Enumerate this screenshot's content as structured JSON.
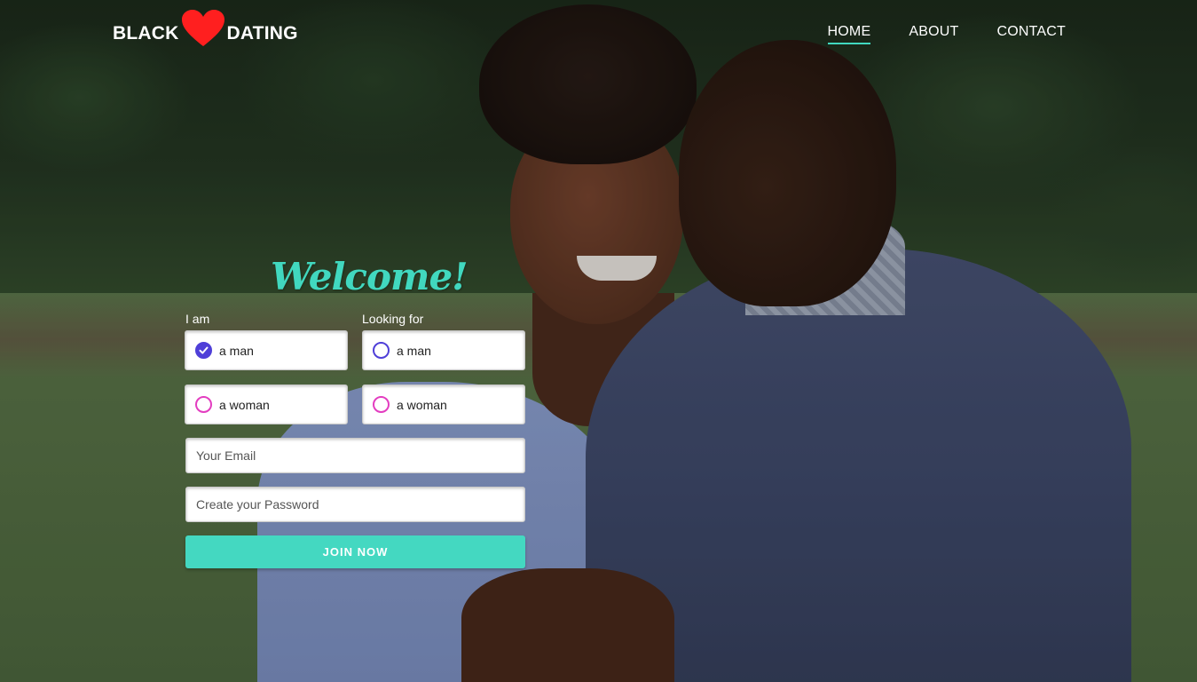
{
  "logo": {
    "word_left": "BLACK",
    "word_right": "DATING",
    "heart_icon": "heart-icon",
    "heart_color": "#ff1f1f"
  },
  "nav": {
    "items": [
      {
        "label": "HOME",
        "active": true
      },
      {
        "label": "ABOUT",
        "active": false
      },
      {
        "label": "CONTACT",
        "active": false
      }
    ],
    "active_underline_color": "#41d8bf"
  },
  "form": {
    "heading": "Welcome!",
    "i_am": {
      "label": "I am",
      "options": [
        {
          "label": "a man",
          "checked": true,
          "color": "#4f3fd8"
        },
        {
          "label": "a woman",
          "checked": false,
          "color": "#e33dc0"
        }
      ]
    },
    "looking_for": {
      "label": "Looking for",
      "options": [
        {
          "label": "a man",
          "checked": false,
          "color": "#4f3fd8"
        },
        {
          "label": "a woman",
          "checked": false,
          "color": "#e33dc0"
        }
      ]
    },
    "email": {
      "placeholder": "Your Email",
      "value": ""
    },
    "password": {
      "placeholder": "Create your Password",
      "value": ""
    },
    "submit_label": "JOIN NOW",
    "accent_color": "#44d8c1"
  }
}
